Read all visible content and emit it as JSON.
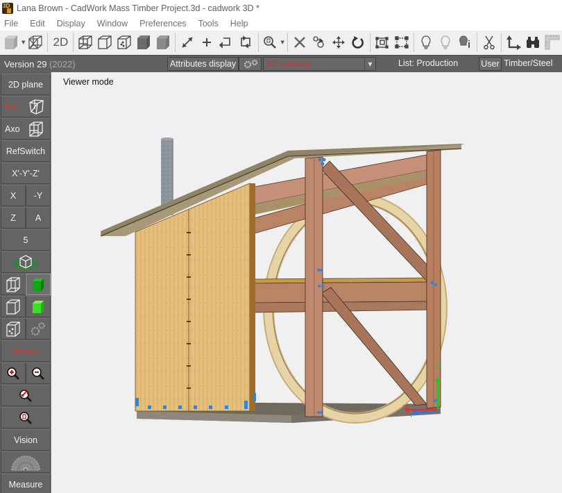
{
  "window": {
    "title": "Lana Brown - CadWork Mass Timber Project.3d - cadwork 3D *"
  },
  "menu": {
    "items": [
      "File",
      "Edit",
      "Display",
      "Window",
      "Preferences",
      "Tools",
      "Help"
    ]
  },
  "toolbar": {
    "items": [
      {
        "icon": "solid-cube-icon",
        "label": ""
      },
      {
        "icon": "dropdown-arrow-icon",
        "label": ""
      },
      {
        "icon": "wireframe-cube-icon",
        "label": ""
      },
      {
        "icon": "2d-view-icon",
        "label": "2D"
      },
      {
        "icon": "wireframe-hidden-cube-icon",
        "label": ""
      },
      {
        "icon": "outline-cube-icon",
        "label": ""
      },
      {
        "icon": "dotted-cube-icon",
        "label": ""
      },
      {
        "icon": "shaded-cube-icon",
        "label": ""
      },
      {
        "icon": "shaded-light-cube-icon",
        "label": ""
      },
      {
        "icon": "resize-arrow-icon",
        "label": ""
      },
      {
        "icon": "plus-icon",
        "label": ""
      },
      {
        "icon": "undo-loop-icon",
        "label": ""
      },
      {
        "icon": "redo-loop-icon",
        "label": ""
      },
      {
        "icon": "zoom-window-icon",
        "label": ""
      },
      {
        "icon": "delete-x-icon",
        "label": ""
      },
      {
        "icon": "copy-move-icon",
        "label": ""
      },
      {
        "icon": "move-arrows-icon",
        "label": ""
      },
      {
        "icon": "rotate-icon",
        "label": ""
      },
      {
        "icon": "select-frame-icon",
        "label": ""
      },
      {
        "icon": "select-dotted-frame-icon",
        "label": ""
      },
      {
        "icon": "bulb-on-icon",
        "label": ""
      },
      {
        "icon": "bulb-off-icon",
        "label": ""
      },
      {
        "icon": "bulb-info-icon",
        "label": ""
      },
      {
        "icon": "scissors-icon",
        "label": ""
      },
      {
        "icon": "axis-arrows-icon",
        "label": ""
      },
      {
        "icon": "binoculars-icon",
        "label": ""
      },
      {
        "icon": "ruler-icon",
        "label": ""
      }
    ]
  },
  "infobar": {
    "version": "Version 29",
    "year": "(2022)",
    "attributes_display": "Attributes display",
    "settings_value": "3D settings",
    "list_label": "List: Production",
    "user_button": "User",
    "mode_label": "Timber/Steel"
  },
  "leftpanel": {
    "plane_2d": "2D plane",
    "per": "Per",
    "axo": "Axo",
    "refswitch": "RefSwitch",
    "xyz": "X'-Y'-Z'",
    "x": "X",
    "neg_y": "-Y",
    "z": "Z",
    "a": "A",
    "five": "5",
    "m_auto": "M Auto",
    "vision": "Vision",
    "measure": "Measure"
  },
  "viewport": {
    "mode_label": "Viewer mode",
    "axis_labels": {
      "z": "Z",
      "x": "X",
      "y": "Y"
    },
    "colors": {
      "background": "#f0f0f0",
      "timber": "#b88560",
      "panel": "#e3bd7c",
      "roof": "#9d8f6e",
      "floor": "#7a7468",
      "arch": "#e3cfa0",
      "chimney": "#8e949a",
      "connector": "#2d86d9",
      "axis_z": "#1ec81e",
      "axis_x": "#e03030",
      "axis_y": "#2a79d8"
    }
  }
}
